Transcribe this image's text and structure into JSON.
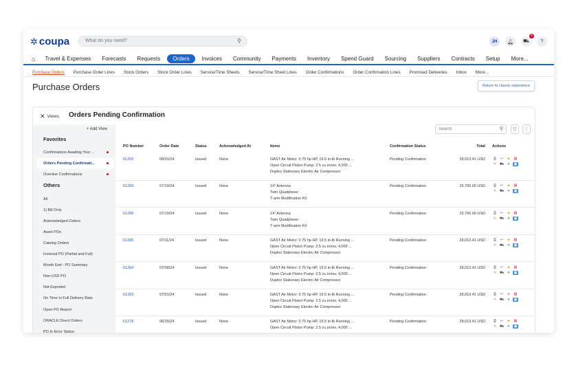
{
  "brand": {
    "name": "coupa"
  },
  "search": {
    "placeholder": "What do you need?"
  },
  "top_icons": {
    "avatar": "JH",
    "cart_badge": "6",
    "help": "?"
  },
  "main_nav": {
    "items": [
      "Travel & Expenses",
      "Forecasts",
      "Requests",
      "Orders",
      "Invoices",
      "Community",
      "Payments",
      "Inventory",
      "Spend Guard",
      "Sourcing",
      "Suppliers",
      "Contracts",
      "Setup",
      "More..."
    ],
    "active": "Orders"
  },
  "sub_nav": {
    "items": [
      "Purchase Orders",
      "Purchase Order Lines",
      "Stock Orders",
      "Stock Order Lines",
      "Service/Time Sheets",
      "Service/Time Sheet Lines",
      "Order Confirmations",
      "Order Confirmation Lines",
      "Promised Deliveries",
      "Inbox",
      "More..."
    ],
    "active": "Purchase Orders"
  },
  "page": {
    "title": "Purchase Orders",
    "return_button": "Return to classic experience"
  },
  "panel": {
    "views_label": "Views",
    "title": "Orders Pending Confirmation",
    "add_view": "+ Add View",
    "search_placeholder": "Search"
  },
  "sidebar": {
    "favorites_title": "Favorites",
    "favorites": [
      {
        "label": "Confirmations Awaiting Your ...",
        "dot": true,
        "selected": false
      },
      {
        "label": "Orders Pending Confirmati...",
        "dot": true,
        "selected": true
      },
      {
        "label": "Overdue Confirmations",
        "dot": true,
        "selected": false
      }
    ],
    "others_title": "Others",
    "others": [
      "All",
      "1) Bill Only",
      "Acknowledged Orders",
      "Asset POs",
      "Catalog Orders",
      "Invoiced PO (Partial and Full)",
      "Month End - PO Summary",
      "Non-USD PO",
      "Not Exported",
      "On Time In Full Delivery Rate",
      "Open PO Report",
      "ORACLE Direct Orders",
      "PO In Error Status"
    ]
  },
  "table": {
    "columns": [
      "PO Number",
      "Order Date",
      "Status",
      "Acknowledged At",
      "Items",
      "Confirmation Status",
      "Total",
      "Actions"
    ],
    "rows": [
      {
        "po": "61293",
        "date": "08/01/24",
        "status": "Issued",
        "ack": "None",
        "items": [
          "GAST Air Motor: 0.75 hp HP, 19.5 in-lb Running ...",
          "Open Circuit Piston Pump: 2.5 cu in/rev, 4,000 ...",
          "Duplex Stationary Electric Air Compressor"
        ],
        "conf": "Pending Confirmation",
        "total": "28,013.41 USD"
      },
      {
        "po": "61289",
        "date": "07/19/24",
        "status": "Issued",
        "ack": "None",
        "items": [
          "14\" Antenna",
          "Twin Quadplexer",
          "T-arm Modification Kit"
        ],
        "conf": "Pending Confirmation",
        "total": "25,700.00 USD"
      },
      {
        "po": "61288",
        "date": "07/19/24",
        "status": "Issued",
        "ack": "None",
        "items": [
          "14\" Antenna",
          "Twin Quadplexer",
          "T-arm Modification Kit"
        ],
        "conf": "Pending Confirmation",
        "total": "25,700.00 USD"
      },
      {
        "po": "61286",
        "date": "07/11/24",
        "status": "Issued",
        "ack": "None",
        "items": [
          "GAST Air Motor: 0.75 hp HP, 19.5 in-lb Running ...",
          "Open Circuit Piston Pump: 2.5 cu in/rev, 4,000 ...",
          "Duplex Stationary Electric Air Compressor"
        ],
        "conf": "Pending Confirmation",
        "total": "28,013.41 USD"
      },
      {
        "po": "61284",
        "date": "07/08/24",
        "status": "Issued",
        "ack": "None",
        "items": [
          "GAST Air Motor: 0.75 hp HP, 19.5 in-lb Running ...",
          "Open Circuit Piston Pump: 2.5 cu in/rev, 4,000 ...",
          "Duplex Stationary Electric Air Compressor"
        ],
        "conf": "Pending Confirmation",
        "total": "28,013.41 USD"
      },
      {
        "po": "61283",
        "date": "07/01/24",
        "status": "Issued",
        "ack": "None",
        "items": [
          "GAST Air Motor: 0.75 hp HP, 19.5 in-lb Running ...",
          "Open Circuit Piston Pump: 2.5 cu in/rev, 4,000 ...",
          "Duplex Stationary Electric Air Compressor"
        ],
        "conf": "Pending Confirmation",
        "total": "28,013.41 USD"
      },
      {
        "po": "61278",
        "date": "06/25/24",
        "status": "Issued",
        "ack": "None",
        "items": [
          "GAST Air Motor: 0.75 hp HP, 19.5 in-lb Running ...",
          "Open Circuit Piston Pump: 2.5 cu in/rev, 4,000 ..."
        ],
        "conf": "Pending Confirmation",
        "total": "28,013.41 USD"
      }
    ]
  },
  "colors": {
    "accent": "#1d63c9",
    "brand": "#0a3d91",
    "active_subnav": "#c94b1d",
    "alert": "#d0021b"
  }
}
